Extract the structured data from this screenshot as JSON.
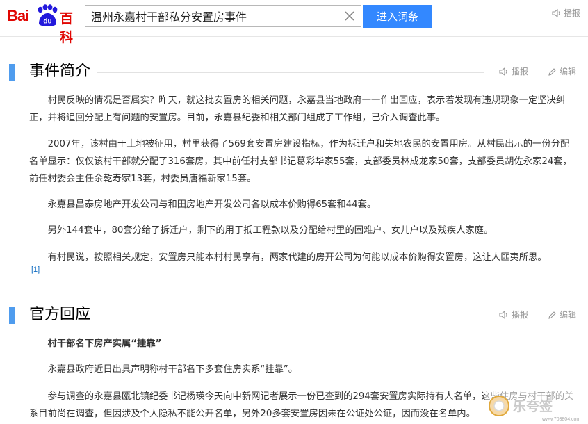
{
  "header": {
    "logo_text_bai": "Bai",
    "logo_text_du": "du",
    "logo_text_baike": "百科",
    "search_value": "温州永嘉村干部私分安置房事件",
    "search_button": "进入词条",
    "speak_label": "播报"
  },
  "sections": [
    {
      "title": "事件简介",
      "speak_label": "播报",
      "edit_label": "编辑",
      "paragraphs": [
        "村民反映的情况是否属实？昨天，就这批安置房的相关问题，永嘉县当地政府一一作出回应，表示若发现有违规现象一定坚决纠正，并将追回分配上有问题的安置房。目前，永嘉县纪委和相关部门组成了工作组，已介入调查此事。",
        "2007年，该村由于土地被征用，村里获得了569套安置房建设指标，作为拆迁户和失地农民的安置用房。从村民出示的一份分配名单显示：仅仅该村干部就分配了316套房，其中前任村支部书记葛彩华家55套，支部委员林成龙家50套，支部委员胡佐永家24套，前任村委会主任余乾寿家13套，村委员唐福新家15套。",
        "永嘉县昌泰房地产开发公司与和田房地产开发公司各以成本价购得65套和44套。",
        "另外144套中，80套分给了拆迁户，剩下的用于抵工程款以及分配给村里的困难户、女儿户以及残疾人家庭。",
        "有村民说，按照相关规定，安置房只能本村村民享有，两家代建的房开公司为何能以成本价购得安置房，这让人匪夷所思。"
      ],
      "ref": "[1]"
    },
    {
      "title": "官方回应",
      "speak_label": "播报",
      "edit_label": "编辑",
      "subtitle": "村干部名下房产实属“挂靠”",
      "paragraphs": [
        "永嘉县政府近日出具声明称村干部名下多套住房实系“挂靠”。",
        "参与调查的永嘉县瓯北镇纪委书记杨瑛今天向中新网记者展示一份已查到的294套安置房实际持有人名单，这些住房与村干部的关系目前尚在调查，但因涉及个人隐私不能公开名单，另外20多套安置房因未在公证处公证，因而没在名单内。"
      ]
    }
  ],
  "watermark": {
    "text": "乐夸签",
    "url": "www.703804.com"
  },
  "colors": {
    "brand_red": "#e10602",
    "brand_blue": "#2319dc",
    "button_blue": "#3388ff",
    "section_bar": "#4f9cee",
    "link": "#136ec2"
  }
}
